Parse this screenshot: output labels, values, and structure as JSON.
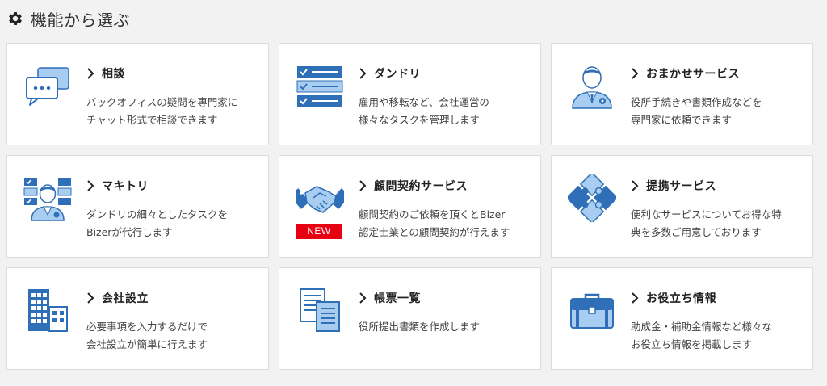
{
  "header": {
    "title": "機能から選ぶ"
  },
  "colors": {
    "accent": "#2f6fb7",
    "light": "#a9cdf0",
    "badge": "#e60012"
  },
  "cards": [
    {
      "title": "相談",
      "desc1": "バックオフィスの疑問を専門家に",
      "desc2": "チャット形式で相談できます",
      "icon": "chat-bubbles-icon"
    },
    {
      "title": "ダンドリ",
      "desc1": "雇用や移転など、会社運営の",
      "desc2": "様々なタスクを管理します",
      "icon": "checklist-icon"
    },
    {
      "title": "おまかせサービス",
      "desc1": "役所手続きや書類作成などを",
      "desc2": "専門家に依頼できます",
      "icon": "expert-person-icon"
    },
    {
      "title": "マキトリ",
      "desc1": "ダンドリの細々としたタスクを",
      "desc2": "Bizerが代行します",
      "icon": "person-checklist-icon"
    },
    {
      "title": "顧問契約サービス",
      "desc1": "顧問契約のご依頼を頂くとBizer",
      "desc2": "認定士業との顧問契約が行えます",
      "icon": "handshake-icon",
      "badge": "NEW"
    },
    {
      "title": "提携サービス",
      "desc1": "便利なサービスについてお得な特",
      "desc2": "典を多数ご用意しております",
      "icon": "puzzle-icon"
    },
    {
      "title": "会社設立",
      "desc1": "必要事項を入力するだけで",
      "desc2": "会社設立が簡単に行えます",
      "icon": "building-icon"
    },
    {
      "title": "帳票一覧",
      "desc1": "役所提出書類を作成します",
      "desc2": "",
      "icon": "documents-icon"
    },
    {
      "title": "お役立ち情報",
      "desc1": "助成金・補助金情報など様々な",
      "desc2": "お役立ち情報を掲載します",
      "icon": "briefcase-icon"
    }
  ]
}
